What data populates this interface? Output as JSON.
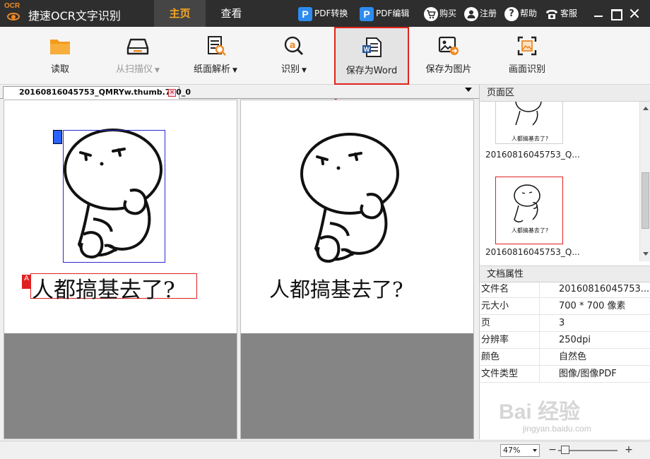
{
  "app": {
    "logo_text": "OCR",
    "title": "捷速OCR文字识别"
  },
  "nav": {
    "tabs": [
      {
        "label": "主页",
        "active": true
      },
      {
        "label": "查看",
        "active": false
      }
    ]
  },
  "top_links": {
    "pdf_convert": "PDF转换",
    "pdf_edit": "PDF编辑",
    "buy": "购买",
    "register": "注册",
    "help": "帮助",
    "service": "客服",
    "pdf_icon_letter": "P"
  },
  "toolbar": {
    "read": "读取",
    "scan": "从扫描仪",
    "parse": "纸面解析",
    "recognize": "识别",
    "save_word": "保存为Word",
    "save_image": "保存为图片",
    "screen_recognize": "画面识别"
  },
  "document": {
    "tab_name": "20160816045753_QMRYw.thumb.700_0",
    "caption_text": "人都搞基去了?"
  },
  "right_panel": {
    "pages_header": "页面区",
    "thumb_names": [
      "20160816045753_Q...",
      "20160816045753_Q..."
    ],
    "props_header": "文档属性",
    "properties": [
      {
        "key": "文件名",
        "value": "20160816045753..."
      },
      {
        "key": "元大小",
        "value": "700 * 700 像素"
      },
      {
        "key": "页",
        "value": "3"
      },
      {
        "key": "分辨率",
        "value": "250dpi"
      },
      {
        "key": "颜色",
        "value": "自然色"
      },
      {
        "key": "文件类型",
        "value": "图像/图像PDF"
      }
    ]
  },
  "status": {
    "zoom": "47%",
    "zoom_out": "−",
    "zoom_in": "+"
  },
  "watermark": {
    "text": "Bai 经验",
    "sub": "jingyan.baidu.com"
  },
  "colors": {
    "titlebar": "#2e2e2e",
    "active_tab_text": "#f5a623",
    "accent_orange": "#f08a24",
    "highlight_red": "#e2231a",
    "pdf_blue": "#2d8cf0"
  }
}
